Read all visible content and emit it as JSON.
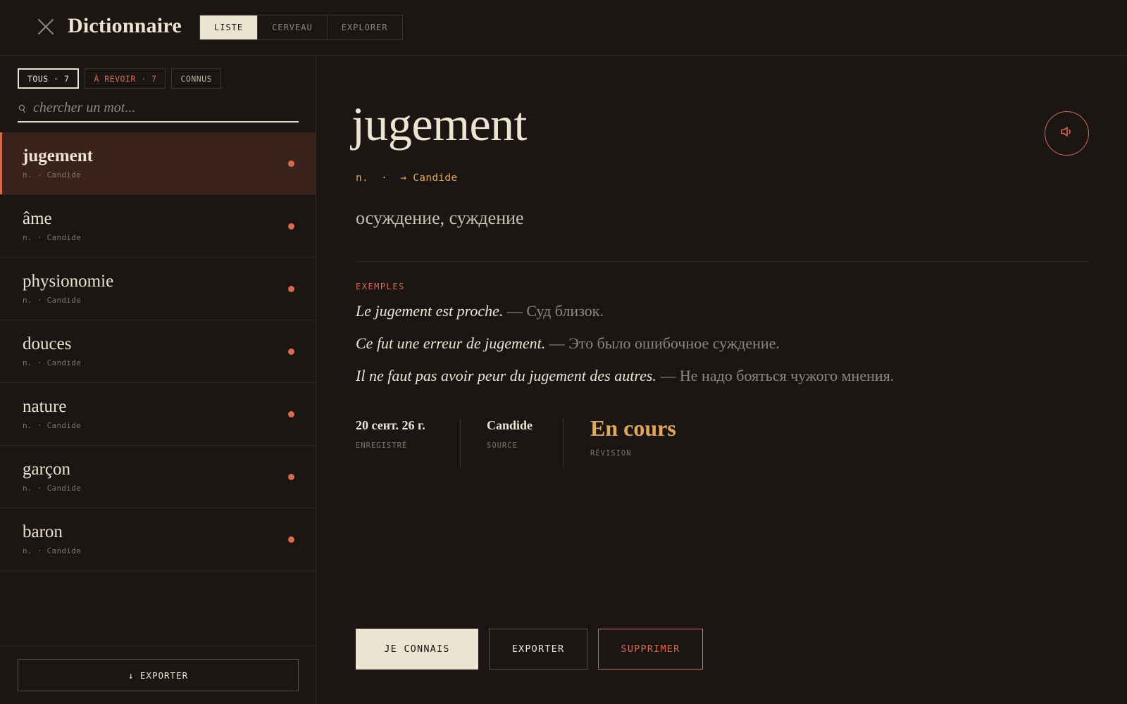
{
  "header": {
    "title": "Dictionnaire",
    "tabs": [
      {
        "label": "LISTE",
        "active": true
      },
      {
        "label": "CERVEAU",
        "active": false
      },
      {
        "label": "EXPLORER",
        "active": false
      }
    ]
  },
  "sidebar": {
    "filters": {
      "all": "TOUS · 7",
      "review": "À REVOIR · 7",
      "known": "CONNUS"
    },
    "search_placeholder": "chercher un mot...",
    "words": [
      {
        "word": "jugement",
        "meta": "n. · Candide",
        "selected": true
      },
      {
        "word": "âme",
        "meta": "n. · Candide",
        "selected": false
      },
      {
        "word": "physionomie",
        "meta": "n. · Candide",
        "selected": false
      },
      {
        "word": "douces",
        "meta": "n. · Candide",
        "selected": false
      },
      {
        "word": "nature",
        "meta": "n. · Candide",
        "selected": false
      },
      {
        "word": "garçon",
        "meta": "n. · Candide",
        "selected": false
      },
      {
        "word": "baron",
        "meta": "n. · Candide",
        "selected": false
      }
    ],
    "export_label": "↓ EXPORTER"
  },
  "detail": {
    "headword": "jugement",
    "pos_line": "n.  ·  → Candide",
    "translation": "осуждение, суждение",
    "examples_label": "EXEMPLES",
    "examples": [
      {
        "fr": "Le jugement est proche.",
        "ru": " — Суд близок."
      },
      {
        "fr": "Ce fut une erreur de jugement.",
        "ru": " — Это было ошибочное суждение."
      },
      {
        "fr": "Il ne faut pas avoir peur du jugement des autres.",
        "ru": " — Не надо бояться чужого мнения."
      }
    ],
    "stats": {
      "saved_value": "20 сент. 26 г.",
      "saved_label": "ENREGISTRÉ",
      "source_value": "Candide",
      "source_label": "SOURCE",
      "review_value": "En cours",
      "review_label": "RÉVISION"
    },
    "actions": {
      "know": "JE CONNAIS",
      "export": "EXPORTER",
      "delete": "SUPPRIMER"
    }
  },
  "colors": {
    "background": "#1b1613",
    "accent": "#d96a4e",
    "gold": "#e0a85a",
    "cream": "#ece3d0"
  },
  "icons": {
    "close": "close-icon",
    "search": "search-icon",
    "audio": "speaker-icon"
  }
}
